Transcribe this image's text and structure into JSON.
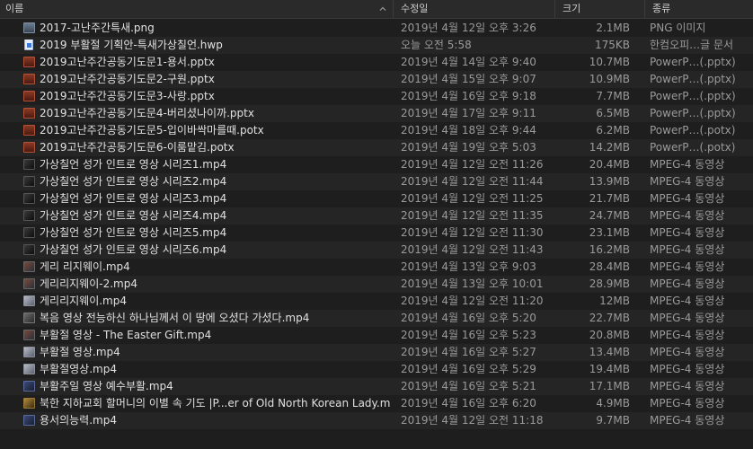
{
  "columns": {
    "name": "이름",
    "date": "수정일",
    "size": "크기",
    "kind": "종류"
  },
  "files": [
    {
      "name": "2017-고난주간특새.png",
      "date": "2019년 4월 12일 오후 3:26",
      "size": "2.1MB",
      "kind": "PNG 이미지",
      "icon": "png-file-icon"
    },
    {
      "name": "2019 부활절 기획안-특새가상칠언.hwp",
      "date": "오늘 오전 5:58",
      "size": "175KB",
      "kind": "한컴오피…글 문서",
      "icon": "hwp-document-icon"
    },
    {
      "name": "2019고난주간공동기도문1-용서.pptx",
      "date": "2019년 4월 14일 오후 9:40",
      "size": "10.7MB",
      "kind": "PowerP…(.pptx)",
      "icon": "powerpoint-file-icon"
    },
    {
      "name": "2019고난주간공동기도문2-구원.pptx",
      "date": "2019년 4월 15일 오후 9:07",
      "size": "10.9MB",
      "kind": "PowerP…(.pptx)",
      "icon": "powerpoint-file-icon"
    },
    {
      "name": "2019고난주간공동기도문3-사랑.pptx",
      "date": "2019년 4월 16일 오후 9:18",
      "size": "7.7MB",
      "kind": "PowerP…(.pptx)",
      "icon": "powerpoint-file-icon"
    },
    {
      "name": "2019고난주간공동기도문4-버리셨나이까.pptx",
      "date": "2019년 4월 17일 오후 9:11",
      "size": "6.5MB",
      "kind": "PowerP…(.pptx)",
      "icon": "powerpoint-file-icon"
    },
    {
      "name": "2019고난주간공동기도문5-입이바싹마를때.potx",
      "date": "2019년 4월 18일 오후 9:44",
      "size": "6.2MB",
      "kind": "PowerP…(.potx)",
      "icon": "powerpoint-file-icon"
    },
    {
      "name": "2019고난주간공동기도문6-이룸맡김.potx",
      "date": "2019년 4월 19일 오후 5:03",
      "size": "14.2MB",
      "kind": "PowerP…(.potx)",
      "icon": "powerpoint-file-icon"
    },
    {
      "name": "가상칠언 성가 인트로 영상 시리즈1.mp4",
      "date": "2019년 4월 12일 오전 11:26",
      "size": "20.4MB",
      "kind": "MPEG-4 동영상",
      "icon": "video-thumbnail-icon"
    },
    {
      "name": "가상칠언 성가 인트로 영상 시리즈2.mp4",
      "date": "2019년 4월 12일 오전 11:44",
      "size": "13.9MB",
      "kind": "MPEG-4 동영상",
      "icon": "video-thumbnail-icon"
    },
    {
      "name": "가상칠언 성가 인트로 영상 시리즈3.mp4",
      "date": "2019년 4월 12일 오전 11:25",
      "size": "21.7MB",
      "kind": "MPEG-4 동영상",
      "icon": "video-thumbnail-icon"
    },
    {
      "name": "가상칠언 성가 인트로 영상 시리즈4.mp4",
      "date": "2019년 4월 12일 오전 11:35",
      "size": "24.7MB",
      "kind": "MPEG-4 동영상",
      "icon": "video-thumbnail-icon"
    },
    {
      "name": "가상칠언 성가 인트로 영상 시리즈5.mp4",
      "date": "2019년 4월 12일 오전 11:30",
      "size": "23.1MB",
      "kind": "MPEG-4 동영상",
      "icon": "video-thumbnail-icon"
    },
    {
      "name": "가상칠언 성가 인트로 영상 시리즈6.mp4",
      "date": "2019년 4월 12일 오전 11:43",
      "size": "16.2MB",
      "kind": "MPEG-4 동영상",
      "icon": "video-thumbnail-icon"
    },
    {
      "name": "게리 리지웨이.mp4",
      "date": "2019년 4월 13일 오후 9:03",
      "size": "28.4MB",
      "kind": "MPEG-4 동영상",
      "icon": "video-thumbnail-icon"
    },
    {
      "name": "게리리지웨이-2.mp4",
      "date": "2019년 4월 13일 오후 10:01",
      "size": "28.9MB",
      "kind": "MPEG-4 동영상",
      "icon": "video-thumbnail-icon"
    },
    {
      "name": "게리리지웨이.mp4",
      "date": "2019년 4월 12일 오전 11:20",
      "size": "12MB",
      "kind": "MPEG-4 동영상",
      "icon": "video-thumbnail-icon"
    },
    {
      "name": "복음 영상 전능하신 하나님께서 이 땅에 오셨다 가셨다.mp4",
      "date": "2019년 4월 16일 오후 5:20",
      "size": "22.7MB",
      "kind": "MPEG-4 동영상",
      "icon": "video-thumbnail-icon"
    },
    {
      "name": "부활절 영상 - The Easter Gift.mp4",
      "date": "2019년 4월 16일 오후 5:23",
      "size": "20.8MB",
      "kind": "MPEG-4 동영상",
      "icon": "video-thumbnail-icon"
    },
    {
      "name": "부활절 영상.mp4",
      "date": "2019년 4월 16일 오후 5:27",
      "size": "13.4MB",
      "kind": "MPEG-4 동영상",
      "icon": "video-thumbnail-icon"
    },
    {
      "name": "부활절영상.mp4",
      "date": "2019년 4월 16일 오후 5:29",
      "size": "19.4MB",
      "kind": "MPEG-4 동영상",
      "icon": "video-thumbnail-icon"
    },
    {
      "name": "부활주일 영상 예수부활.mp4",
      "date": "2019년 4월 16일 오후 5:21",
      "size": "17.1MB",
      "kind": "MPEG-4 동영상",
      "icon": "video-thumbnail-icon"
    },
    {
      "name": "북한 지하교회 할머니의 이별 속 기도 |P...er of Old North Korean Lady.mp4",
      "date": "2019년 4월 16일 오후 6:20",
      "size": "4.9MB",
      "kind": "MPEG-4 동영상",
      "icon": "video-thumbnail-icon"
    },
    {
      "name": "용서의능력.mp4",
      "date": "2019년 4월 12일 오전 11:18",
      "size": "9.7MB",
      "kind": "MPEG-4 동영상",
      "icon": "video-thumbnail-icon"
    }
  ]
}
